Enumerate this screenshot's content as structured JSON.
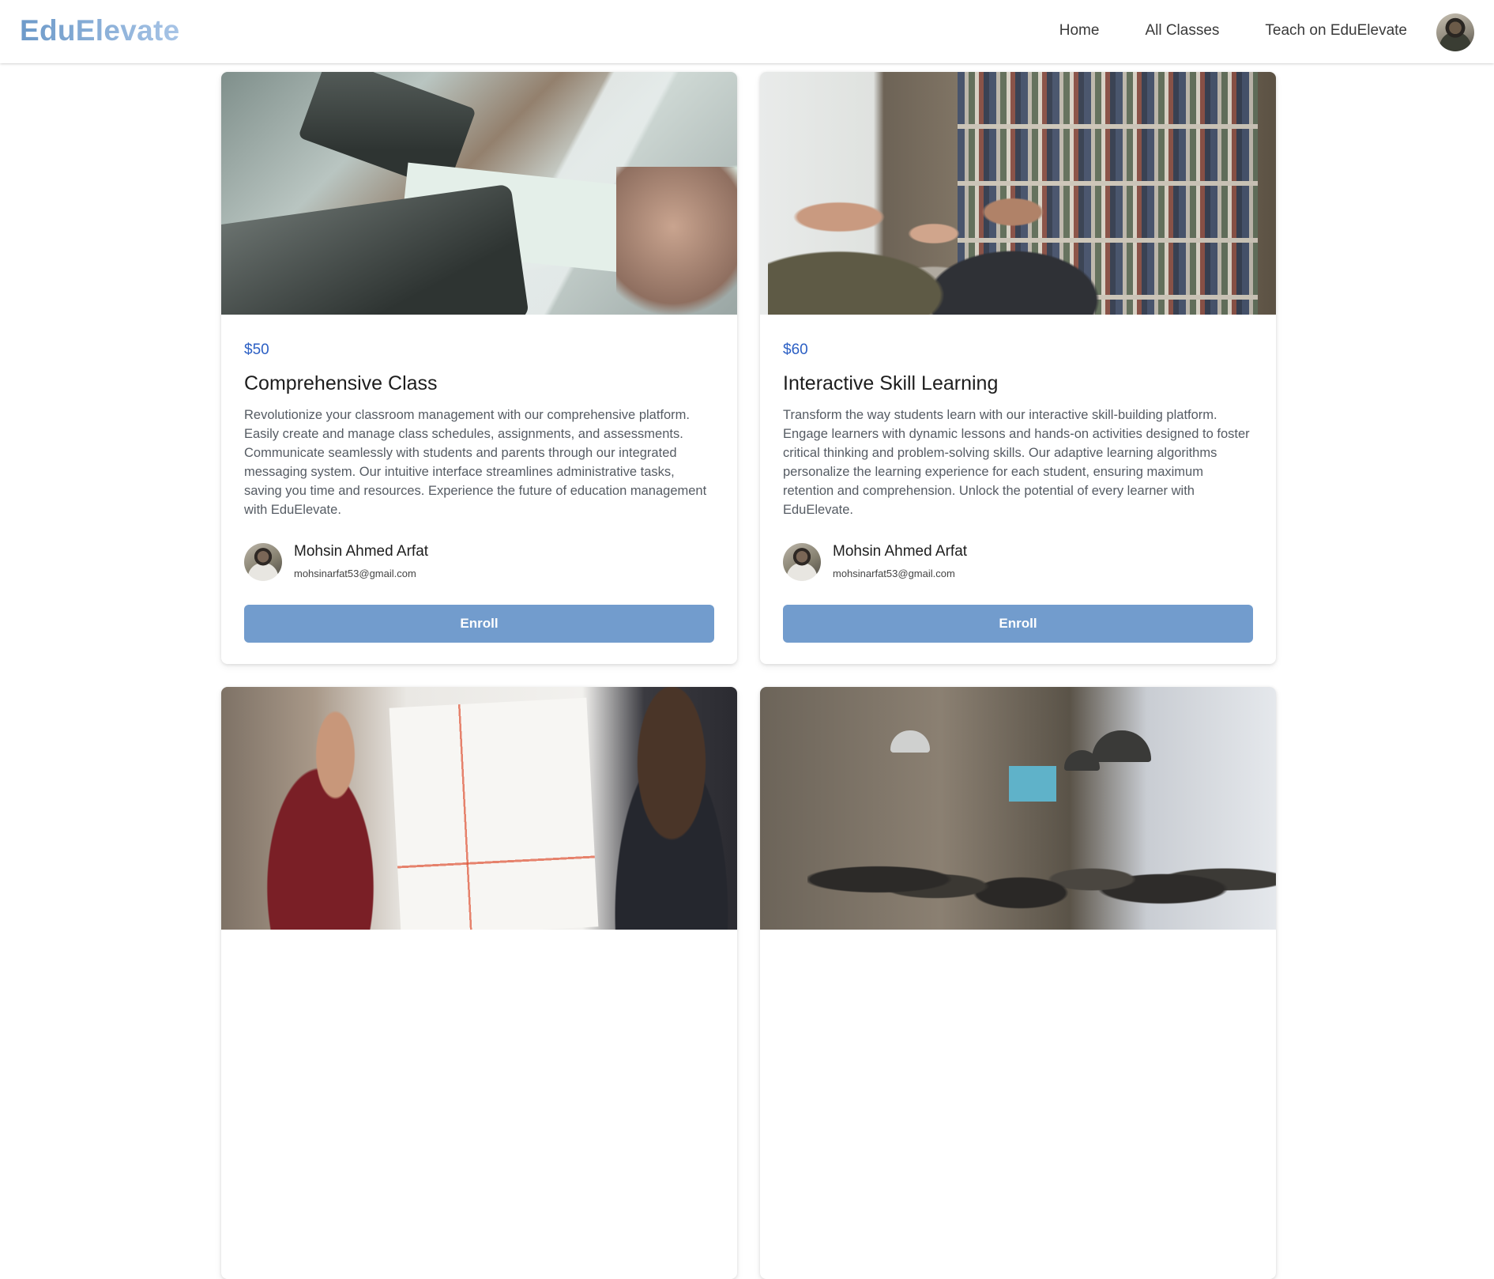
{
  "nav": {
    "brand": "EduElevate",
    "links": [
      "Home",
      "All Classes",
      "Teach on EduElevate"
    ]
  },
  "cards": [
    {
      "price": "$50",
      "title": "Comprehensive Class",
      "description": "Revolutionize your classroom management with our comprehensive platform. Easily create and manage class schedules, assignments, and assessments. Communicate seamlessly with students and parents through our integrated messaging system. Our intuitive interface streamlines administrative tasks, saving you time and resources. Experience the future of education management with EduElevate.",
      "teacher_name": "Mohsin Ahmed Arfat",
      "teacher_email": "mohsinarfat53@gmail.com",
      "button": "Enroll"
    },
    {
      "price": "$60",
      "title": "Interactive Skill Learning",
      "description": "Transform the way students learn with our interactive skill-building platform. Engage learners with dynamic lessons and hands-on activities designed to foster critical thinking and problem-solving skills. Our adaptive learning algorithms personalize the learning experience for each student, ensuring maximum retention and comprehension. Unlock the potential of every learner with EduElevate.",
      "teacher_name": "Mohsin Ahmed Arfat",
      "teacher_email": "mohsinarfat53@gmail.com",
      "button": "Enroll"
    }
  ],
  "colors": {
    "accent_button": "#729ccd",
    "price": "#2b5fc4",
    "brand_gradient_start": "#6d9ac9",
    "brand_gradient_end": "#a7c4e6"
  }
}
